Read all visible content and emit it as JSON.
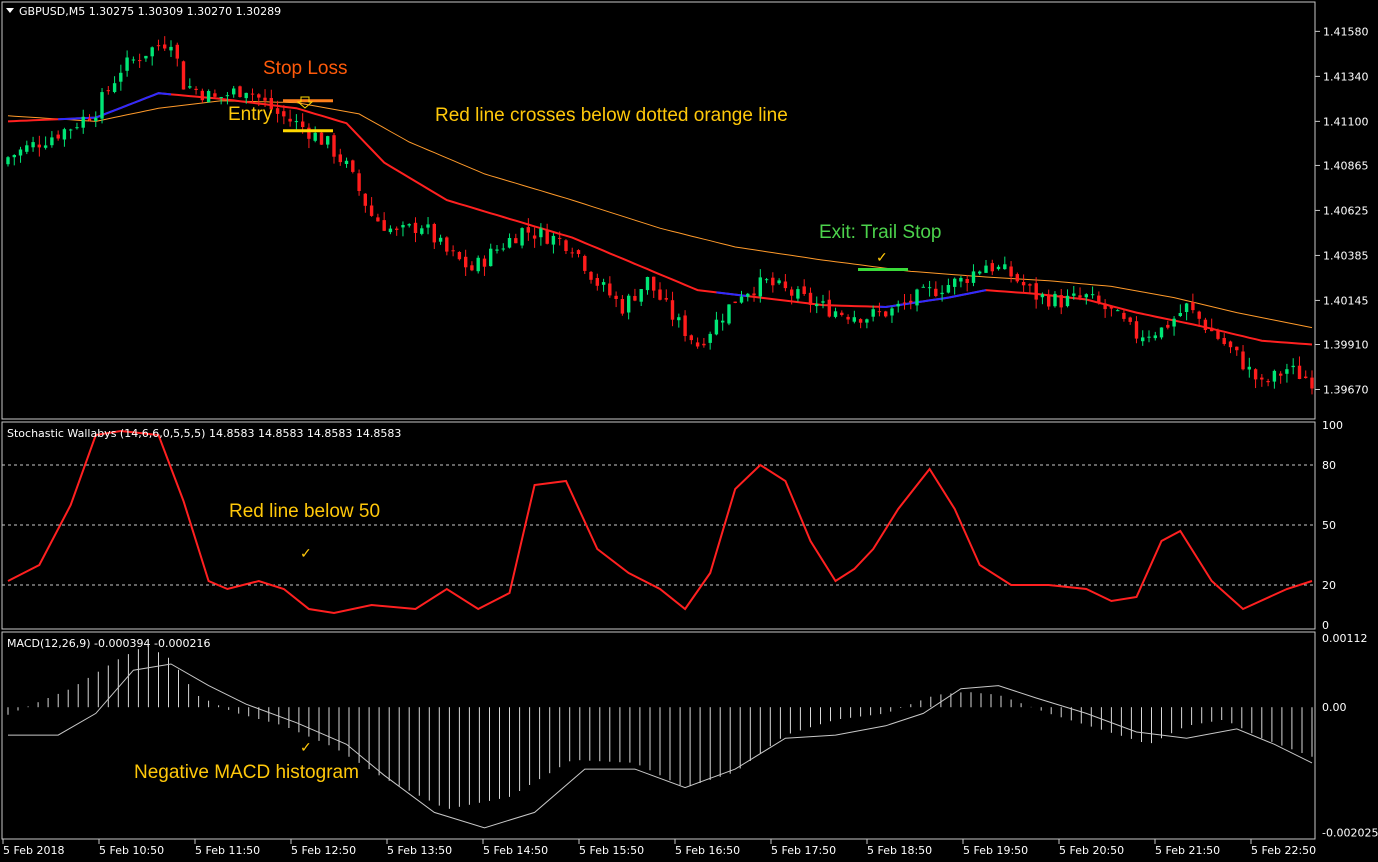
{
  "colors": {
    "bull": "#00e676",
    "bear": "#ff1c1c",
    "ema_fast": "#ff2020",
    "ema_fast_alt": "#2c2cff",
    "ema_slow": "#ff9a2a",
    "stoch": "#ff2020",
    "macd_line": "#c8c8c8",
    "macd_hist": "#d8d8d8",
    "grid_dotted": "#c8c8c8",
    "stop_line": "#ff7f1a",
    "entry_line": "#ffd800",
    "exit_line": "#3adb3a",
    "panel_border": "#c8c8c8"
  },
  "main_panel": {
    "header": "GBPUSD,M5  1.30275 1.30309 1.30270 1.30289",
    "annotations": {
      "stop_loss": "Stop Loss",
      "entry": "Entry",
      "cross": "Red line crosses below dotted orange line",
      "exit": "Exit: Trail Stop"
    }
  },
  "stoch_panel": {
    "header": "Stochastic Wallabys (14,6,6,0,5,5,5) 14.8583 14.8583 14.8583 14.8583",
    "annotation": "Red line below 50",
    "check": "✓"
  },
  "macd_panel": {
    "header": "MACD(12,26,9) -0.000394 -0.000216",
    "annotation": "Negative MACD histogram",
    "check": "✓"
  },
  "exit_check": "✓",
  "chart_data": [
    {
      "type": "candlestick",
      "title": "GBPUSD,M5  1.30275 1.30309 1.30270 1.30289",
      "ylim": [
        1.3955,
        1.4163
      ],
      "yticks": [
        "1.41580",
        "1.41340",
        "1.41100",
        "1.40865",
        "1.40625",
        "1.40385",
        "1.40145",
        "1.39910",
        "1.39670"
      ],
      "xticks": [
        "5 Feb 2018",
        "5 Feb 10:50",
        "5 Feb 11:50",
        "5 Feb 12:50",
        "5 Feb 13:50",
        "5 Feb 14:50",
        "5 Feb 15:50",
        "5 Feb 16:50",
        "5 Feb 17:50",
        "5 Feb 18:50",
        "5 Feb 19:50",
        "5 Feb 20:50",
        "5 Feb 21:50",
        "5 Feb 22:50"
      ],
      "close_profile": [
        [
          0,
          1.4091
        ],
        [
          10,
          1.4107
        ],
        [
          14,
          1.4116
        ],
        [
          18,
          1.4138
        ],
        [
          22,
          1.4147
        ],
        [
          26,
          1.4154
        ],
        [
          28,
          1.413
        ],
        [
          33,
          1.4122
        ],
        [
          38,
          1.4128
        ],
        [
          43,
          1.4114
        ],
        [
          47,
          1.4107
        ],
        [
          51,
          1.4098
        ],
        [
          54,
          1.4086
        ],
        [
          58,
          1.406
        ],
        [
          62,
          1.405
        ],
        [
          66,
          1.4055
        ],
        [
          70,
          1.404
        ],
        [
          74,
          1.4031
        ],
        [
          78,
          1.4042
        ],
        [
          82,
          1.4052
        ],
        [
          86,
          1.4049
        ],
        [
          90,
          1.4044
        ],
        [
          94,
          1.4024
        ],
        [
          98,
          1.4011
        ],
        [
          102,
          1.4025
        ],
        [
          106,
          1.4006
        ],
        [
          110,
          1.3991
        ],
        [
          113,
          1.4003
        ],
        [
          117,
          1.4019
        ],
        [
          121,
          1.4024
        ],
        [
          125,
          1.4018
        ],
        [
          129,
          1.4012
        ],
        [
          133,
          1.4008
        ],
        [
          137,
          1.4006
        ],
        [
          141,
          1.4009
        ],
        [
          145,
          1.4016
        ],
        [
          149,
          1.4022
        ],
        [
          152,
          1.4025
        ],
        [
          156,
          1.4034
        ],
        [
          160,
          1.4028
        ],
        [
          164,
          1.4017
        ],
        [
          168,
          1.4014
        ],
        [
          172,
          1.4016
        ],
        [
          176,
          1.4008
        ],
        [
          180,
          1.3996
        ],
        [
          184,
          1.3999
        ],
        [
          188,
          1.4011
        ],
        [
          192,
          1.3998
        ],
        [
          196,
          1.3985
        ],
        [
          200,
          1.3969
        ],
        [
          204,
          1.3978
        ],
        [
          208,
          1.3972
        ]
      ],
      "ema_fast_profile": [
        [
          0,
          1.411
        ],
        [
          14,
          1.4112
        ],
        [
          24,
          1.4125
        ],
        [
          34,
          1.4122
        ],
        [
          46,
          1.4117
        ],
        [
          54,
          1.4109
        ],
        [
          60,
          1.4088
        ],
        [
          70,
          1.4068
        ],
        [
          80,
          1.4058
        ],
        [
          90,
          1.4048
        ],
        [
          100,
          1.4034
        ],
        [
          110,
          1.402
        ],
        [
          120,
          1.4016
        ],
        [
          130,
          1.4012
        ],
        [
          140,
          1.4011
        ],
        [
          150,
          1.4016
        ],
        [
          156,
          1.402
        ],
        [
          164,
          1.4018
        ],
        [
          172,
          1.4015
        ],
        [
          180,
          1.4008
        ],
        [
          190,
          1.4001
        ],
        [
          200,
          1.3993
        ],
        [
          208,
          1.3991
        ]
      ],
      "ema_slow_profile": [
        [
          0,
          1.4113
        ],
        [
          14,
          1.411
        ],
        [
          24,
          1.4117
        ],
        [
          34,
          1.4121
        ],
        [
          46,
          1.412
        ],
        [
          56,
          1.4114
        ],
        [
          64,
          1.4099
        ],
        [
          76,
          1.4082
        ],
        [
          90,
          1.4068
        ],
        [
          104,
          1.4053
        ],
        [
          116,
          1.4043
        ],
        [
          130,
          1.4036
        ],
        [
          144,
          1.403
        ],
        [
          156,
          1.4027
        ],
        [
          166,
          1.4025
        ],
        [
          176,
          1.4022
        ],
        [
          186,
          1.4016
        ],
        [
          196,
          1.4008
        ],
        [
          208,
          1.4
        ]
      ],
      "blue_segments": [
        [
          8,
          26
        ],
        [
          113,
          118
        ],
        [
          139,
          156
        ]
      ],
      "stop_loss_level": 1.4121,
      "entry_level": 1.4105,
      "exit_level": 1.4031
    },
    {
      "type": "line",
      "title": "Stochastic Wallabys (14,6,6,0,5,5,5) 14.8583 14.8583 14.8583 14.8583",
      "ylim": [
        0,
        100
      ],
      "yticks": [
        "100",
        "80",
        "50",
        "20",
        "0"
      ],
      "levels": [
        80,
        50,
        20
      ],
      "series": [
        {
          "values": [
            [
              0,
              22
            ],
            [
              5,
              30
            ],
            [
              10,
              60
            ],
            [
              14,
              95
            ],
            [
              18,
              97
            ],
            [
              24,
              95
            ],
            [
              28,
              62
            ],
            [
              32,
              22
            ],
            [
              35,
              18
            ],
            [
              40,
              22
            ],
            [
              44,
              18
            ],
            [
              48,
              8
            ],
            [
              52,
              6
            ],
            [
              58,
              10
            ],
            [
              65,
              8
            ],
            [
              70,
              18
            ],
            [
              75,
              8
            ],
            [
              80,
              16
            ],
            [
              84,
              70
            ],
            [
              89,
              72
            ],
            [
              94,
              38
            ],
            [
              99,
              26
            ],
            [
              104,
              18
            ],
            [
              108,
              8
            ],
            [
              112,
              26
            ],
            [
              116,
              68
            ],
            [
              120,
              80
            ],
            [
              124,
              72
            ],
            [
              128,
              42
            ],
            [
              132,
              22
            ],
            [
              135,
              28
            ],
            [
              138,
              38
            ],
            [
              142,
              58
            ],
            [
              147,
              78
            ],
            [
              151,
              58
            ],
            [
              155,
              30
            ],
            [
              160,
              20
            ],
            [
              166,
              20
            ],
            [
              172,
              18
            ],
            [
              176,
              12
            ],
            [
              180,
              14
            ],
            [
              184,
              42
            ],
            [
              187,
              47
            ],
            [
              192,
              22
            ],
            [
              197,
              8
            ],
            [
              204,
              18
            ],
            [
              208,
              22
            ]
          ]
        }
      ]
    },
    {
      "type": "histogram+line",
      "title": "MACD(12,26,9) -0.000394 -0.000216",
      "ylim": [
        -0.00205,
        0.00112
      ],
      "yticks": [
        "0.00112",
        "0.00",
        "-0.002025"
      ],
      "histogram": [
        [
          0,
          -0.00012
        ],
        [
          10,
          0.0003
        ],
        [
          18,
          0.0008
        ],
        [
          22,
          0.001
        ],
        [
          26,
          0.00078
        ],
        [
          30,
          0.0002
        ],
        [
          36,
          -8e-05
        ],
        [
          44,
          -0.0003
        ],
        [
          52,
          -0.00065
        ],
        [
          60,
          -0.00115
        ],
        [
          70,
          -0.00165
        ],
        [
          80,
          -0.00145
        ],
        [
          90,
          -0.00085
        ],
        [
          100,
          -0.0009
        ],
        [
          108,
          -0.0013
        ],
        [
          116,
          -0.00105
        ],
        [
          124,
          -0.00045
        ],
        [
          132,
          -0.0002
        ],
        [
          140,
          -0.0001
        ],
        [
          148,
          0.0002
        ],
        [
          153,
          0.00025
        ],
        [
          158,
          0.0002
        ],
        [
          166,
          -0.0001
        ],
        [
          174,
          -0.00035
        ],
        [
          182,
          -0.0006
        ],
        [
          188,
          -0.0003
        ],
        [
          194,
          -0.0002
        ],
        [
          200,
          -0.0005
        ],
        [
          208,
          -0.0008
        ]
      ],
      "signal": [
        [
          0,
          -0.00045
        ],
        [
          8,
          -0.00045
        ],
        [
          14,
          -0.0001
        ],
        [
          20,
          0.0006
        ],
        [
          26,
          0.0007
        ],
        [
          32,
          0.00035
        ],
        [
          38,
          5e-05
        ],
        [
          46,
          -0.00025
        ],
        [
          54,
          -0.0006
        ],
        [
          60,
          -0.0011
        ],
        [
          68,
          -0.0017
        ],
        [
          76,
          -0.00195
        ],
        [
          84,
          -0.0017
        ],
        [
          92,
          -0.001
        ],
        [
          100,
          -0.001
        ],
        [
          108,
          -0.0013
        ],
        [
          116,
          -0.001
        ],
        [
          124,
          -0.0005
        ],
        [
          132,
          -0.00045
        ],
        [
          140,
          -0.0003
        ],
        [
          146,
          -0.0001
        ],
        [
          152,
          0.0003
        ],
        [
          158,
          0.00035
        ],
        [
          164,
          0.00015
        ],
        [
          172,
          -0.0001
        ],
        [
          180,
          -0.0004
        ],
        [
          188,
          -0.0005
        ],
        [
          196,
          -0.00035
        ],
        [
          202,
          -0.0006
        ],
        [
          208,
          -0.0009
        ]
      ]
    }
  ]
}
